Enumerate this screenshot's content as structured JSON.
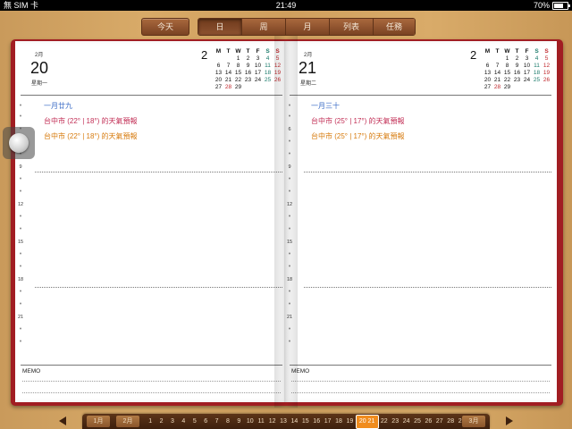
{
  "status": {
    "carrier": "無 SIM 卡",
    "time": "21:49",
    "battery": "70%"
  },
  "toolbar": {
    "today_label": "今天",
    "segments": [
      "日",
      "周",
      "月",
      "列表",
      "任務"
    ],
    "active_segment": "日"
  },
  "left_page": {
    "month_label": "2月",
    "day": "20",
    "weekday": "星期一",
    "events": [
      {
        "text": "一月廿九",
        "color": "blue"
      },
      {
        "text": "台中市 (22° | 18°) 的天氣預報",
        "color": "red"
      },
      {
        "text": "台中市 (22° | 18°) 的天氣預報",
        "color": "orange"
      }
    ],
    "hours": [
      "8",
      "9",
      "12",
      "15",
      "18",
      "21"
    ],
    "memo_label": "MEMO"
  },
  "right_page": {
    "month_label": "2月",
    "day": "21",
    "weekday": "星期二",
    "events": [
      {
        "text": "一月三十",
        "color": "blue"
      },
      {
        "text": "台中市 (25° | 17°) 的天氣預報",
        "color": "red"
      },
      {
        "text": "台中市 (25° | 17°) 的天氣預報",
        "color": "orange"
      }
    ],
    "hours": [
      "6",
      "9",
      "12",
      "15",
      "18",
      "21"
    ],
    "memo_label": "MEMO"
  },
  "mini_calendar": {
    "month": "2",
    "weekday_headers": [
      "M",
      "T",
      "W",
      "T",
      "F",
      "S",
      "S"
    ],
    "weeks": [
      [
        "",
        "",
        "1",
        "2",
        "3",
        "4",
        "5"
      ],
      [
        "6",
        "7",
        "8",
        "9",
        "10",
        "11",
        "12"
      ],
      [
        "13",
        "14",
        "15",
        "16",
        "17",
        "18",
        "19"
      ],
      [
        "20",
        "21",
        "22",
        "23",
        "24",
        "25",
        "26"
      ],
      [
        "27",
        "28",
        "29",
        "",
        "",
        "",
        ""
      ]
    ],
    "highlight": "28"
  },
  "bottom_nav": {
    "prev_month": "1月",
    "month": "2月",
    "days": [
      "1",
      "2",
      "3",
      "4",
      "5",
      "6",
      "7",
      "8",
      "9",
      "10",
      "11",
      "12",
      "13",
      "14",
      "15",
      "16",
      "17",
      "18",
      "19",
      "20 21",
      "22",
      "23",
      "24",
      "25",
      "26",
      "27",
      "28",
      "29"
    ],
    "selected": "20 21",
    "next_month": "3月"
  },
  "colors": {
    "cover": "#a11d22",
    "event_blue": "#3a6bc6",
    "event_red": "#c22e55",
    "event_orange": "#d77b0e",
    "selected_day": "#f08c1e"
  }
}
